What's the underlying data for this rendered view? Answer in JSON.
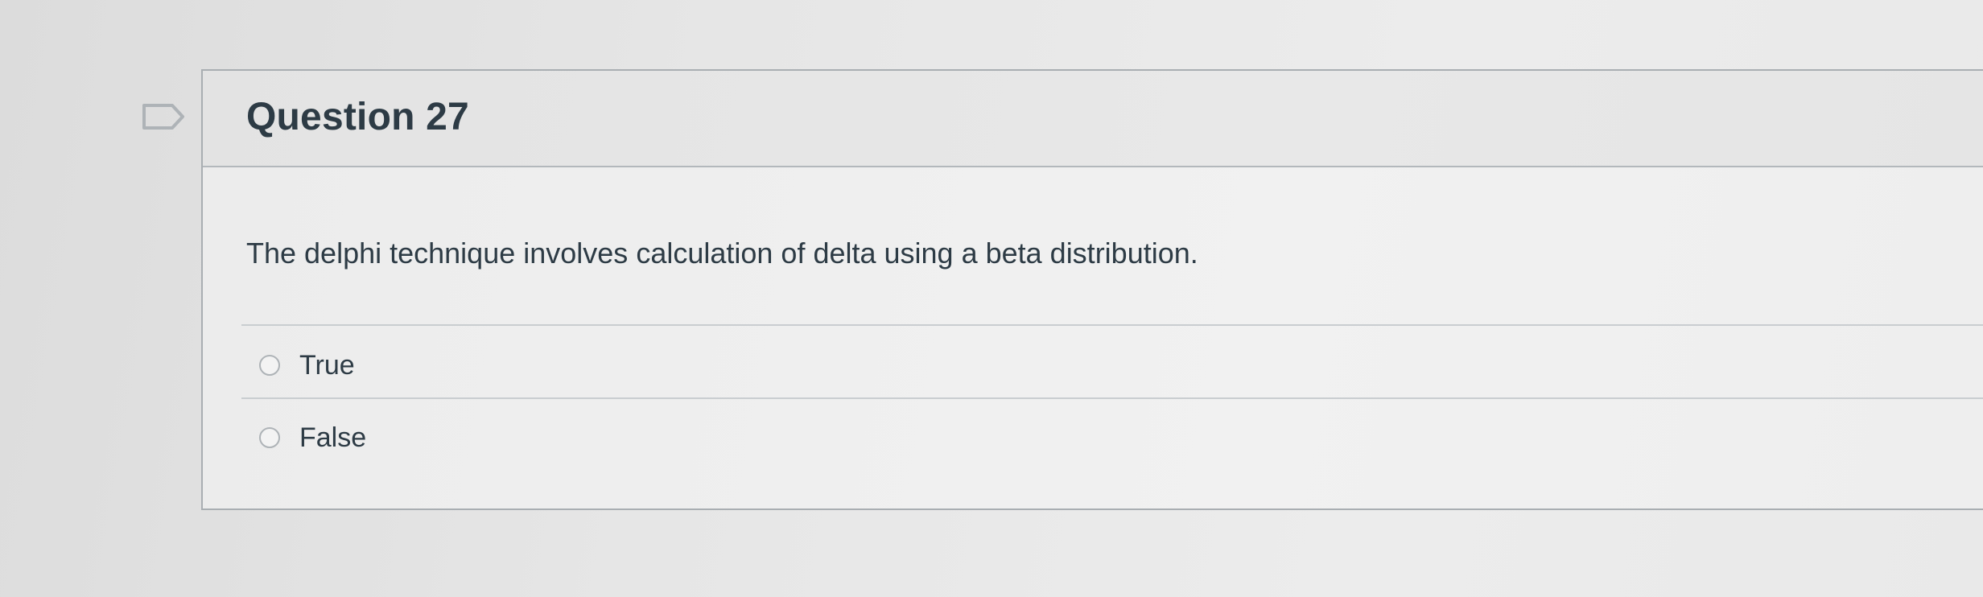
{
  "question": {
    "title": "Question 27",
    "text": "The delphi technique involves calculation of delta using a beta distribution.",
    "answers": [
      {
        "label": "True",
        "selected": false
      },
      {
        "label": "False",
        "selected": false
      }
    ]
  },
  "flag": {
    "icon": "flag-outline-icon",
    "state": "unflagged"
  },
  "colors": {
    "text": "#2d3b45",
    "border": "#a9aeb2",
    "header_bg": "#e5e5e5"
  }
}
